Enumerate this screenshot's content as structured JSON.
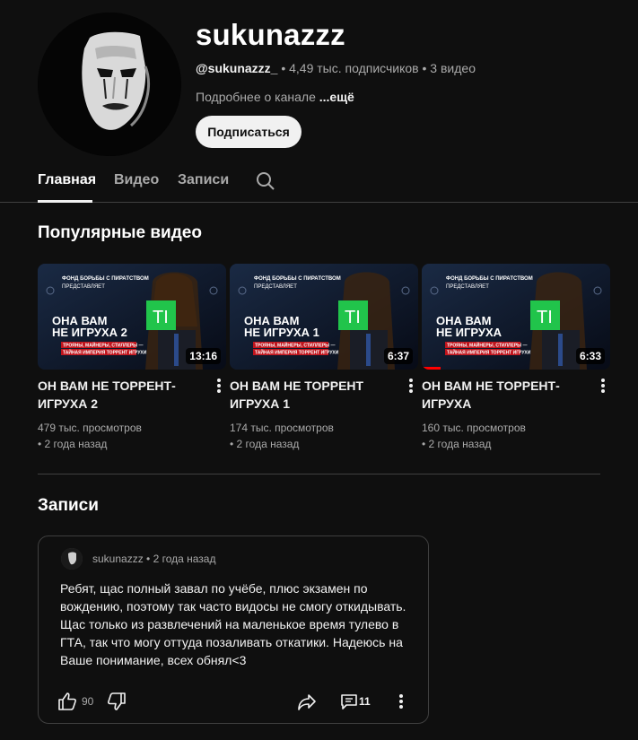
{
  "channel": {
    "name": "sukunazzz",
    "handle": "@sukunazzz_",
    "stats": " • 4,49 тыс. подписчиков • 3 видео",
    "about": "Подробнее о канале ",
    "about_more": "...ещё",
    "subscribe_label": "Подписаться"
  },
  "tabs": [
    {
      "label": "Главная",
      "active": true
    },
    {
      "label": "Видео",
      "active": false
    },
    {
      "label": "Записи",
      "active": false
    }
  ],
  "popular": {
    "title": "Популярные видео",
    "videos": [
      {
        "title": "ОН ВАМ НЕ ТОРРЕНТ-ИГРУХА 2",
        "views": "479 тыс. просмотров",
        "age": "• 2 года назад",
        "duration": "13:16",
        "thumb_headline_1": "ОНА ВАМ",
        "thumb_headline_2": "НЕ ИГРУХА 2",
        "progress": 0
      },
      {
        "title": "ОН ВАМ НЕ ТОРРЕНТ ИГРУХА 1",
        "views": "174 тыс. просмотров",
        "age": "• 2 года назад",
        "duration": "6:37",
        "thumb_headline_1": "ОНА ВАМ",
        "thumb_headline_2": "НЕ ИГРУХА 1",
        "progress": 0
      },
      {
        "title": "ОН ВАМ НЕ ТОРРЕНТ-ИГРУХА",
        "views": "160 тыс. просмотров",
        "age": "• 2 года назад",
        "duration": "6:33",
        "thumb_headline_1": "ОНА ВАМ",
        "thumb_headline_2": "НЕ ИГРУХА",
        "progress": 0.1
      }
    ],
    "thumb_top_line_1": "ФОНД БОРЬБЫ С ПИРАТСТВОМ",
    "thumb_top_line_2": "ПРЕДСТАВЛЯЕТ",
    "thumb_red_1": "ТРОЯНЫ, МАЙНЕРЫ, СТИЛЛЕРЫ —",
    "thumb_red_2": "ТАЙНАЯ ИМПЕРИЯ ТОРРЕНТ ИГРУХИ",
    "thumb_logo": "TI"
  },
  "posts": {
    "title": "Записи",
    "items": [
      {
        "author": "sukunazzz",
        "age": " • 2 года назад",
        "text": "Ребят, щас полный завал по учёбе, плюс экзамен по вождению, поэтому так часто видосы не смогу откидывать. Щас только из развлечений на маленькое время тулево в ГТА, так что могу оттуда позаливать откатики. Надеюсь на Ваше понимание, всех обнял<3",
        "likes": "90",
        "comments": "11"
      }
    ]
  },
  "icons": {
    "search": "search-icon",
    "kebab": "more-vert-icon",
    "like": "thumb-up-icon",
    "dislike": "thumb-down-icon",
    "share": "share-icon",
    "comment": "comment-icon"
  },
  "colors": {
    "background": "#0f0f0f",
    "text": "#f1f1f1",
    "secondary": "#aaaaaa",
    "subscribe_bg": "#f1f1f1",
    "progress": "#ff0000",
    "logo_green": "#21c44b"
  }
}
